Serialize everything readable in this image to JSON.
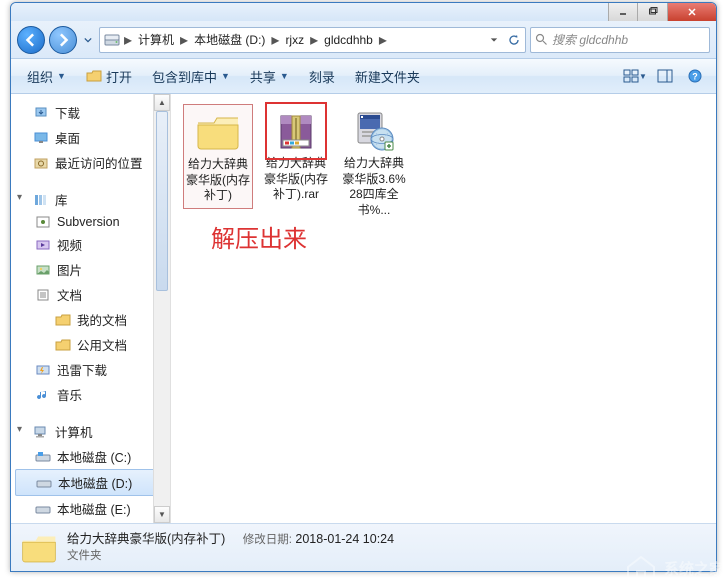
{
  "titlebar": {
    "min": "–",
    "max": "□",
    "close": "×"
  },
  "breadcrumb": {
    "segments": [
      "计算机",
      "本地磁盘 (D:)",
      "rjxz",
      "gldcdhhb"
    ],
    "search_placeholder": "搜索 gldcdhhb"
  },
  "toolbar": {
    "organize": "组织",
    "open": "打开",
    "include": "包含到库中",
    "share": "共享",
    "burn": "刻录",
    "newfolder": "新建文件夹"
  },
  "sidebar": {
    "group1": [
      {
        "label": "下载",
        "icon": "download"
      },
      {
        "label": "桌面",
        "icon": "desktop"
      },
      {
        "label": "最近访问的位置",
        "icon": "recent"
      }
    ],
    "libraries_label": "库",
    "libraries": [
      {
        "label": "Subversion",
        "icon": "svn"
      },
      {
        "label": "视频",
        "icon": "video"
      },
      {
        "label": "图片",
        "icon": "pictures"
      },
      {
        "label": "文档",
        "icon": "docs"
      },
      {
        "label": "我的文档",
        "icon": "folder",
        "child": true
      },
      {
        "label": "公用文档",
        "icon": "folder",
        "child": true
      },
      {
        "label": "迅雷下载",
        "icon": "thunder"
      },
      {
        "label": "音乐",
        "icon": "music"
      }
    ],
    "computer_label": "计算机",
    "drives": [
      {
        "label": "本地磁盘 (C:)",
        "icon": "drive-c"
      },
      {
        "label": "本地磁盘 (D:)",
        "icon": "drive",
        "selected": true
      },
      {
        "label": "本地磁盘 (E:)",
        "icon": "drive"
      }
    ]
  },
  "content": {
    "items": [
      {
        "name": "给力大辞典豪华版(内存补丁)",
        "type": "folder",
        "selected": true
      },
      {
        "name": "给力大辞典豪华版(内存补丁).rar",
        "type": "rar",
        "highlighted": true
      },
      {
        "name": "给力大辞典豪华版3.6%28四库全书%...",
        "type": "exe"
      }
    ],
    "annotation": "解压出来"
  },
  "status": {
    "name": "给力大辞典豪华版(内存补丁)",
    "modlabel": "修改日期:",
    "moddate": "2018-01-24 10:24",
    "type": "文件夹"
  },
  "watermark": "系统之家"
}
